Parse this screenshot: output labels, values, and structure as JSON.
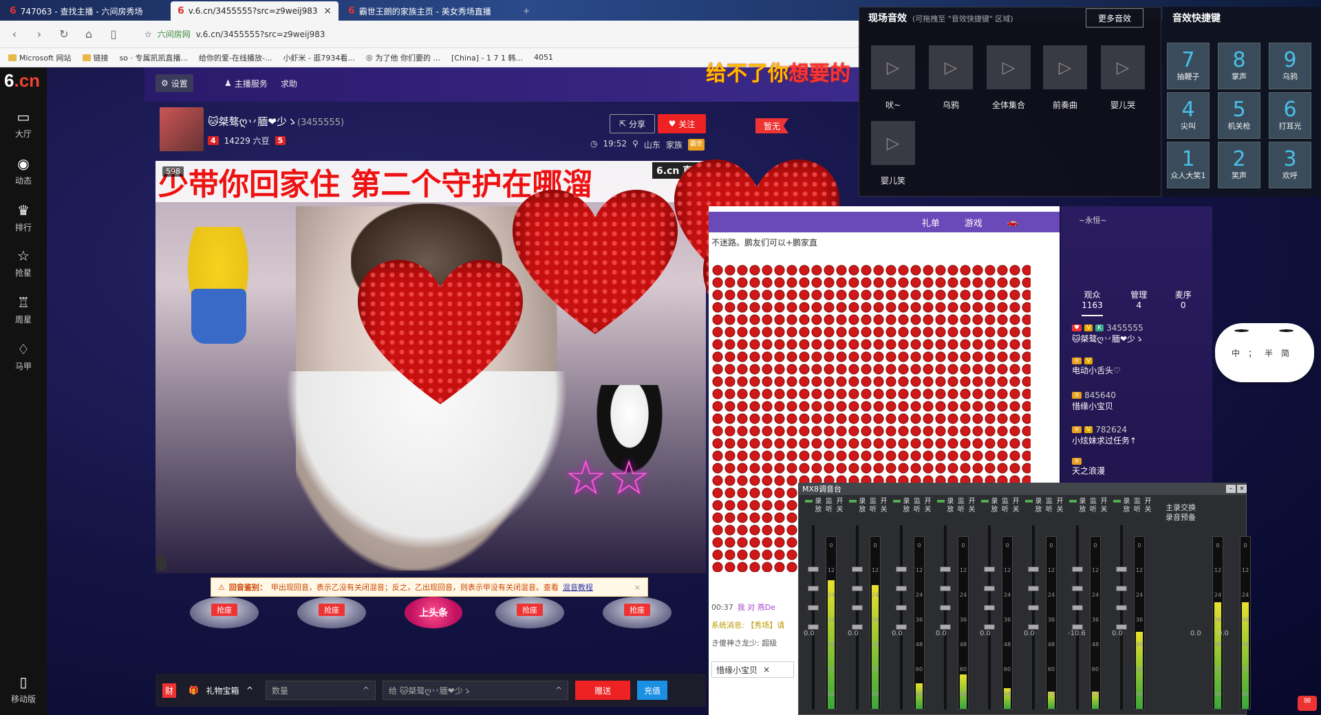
{
  "browser": {
    "tabs": [
      {
        "label": "747063 - 查找主播 - 六间房秀场",
        "active": false
      },
      {
        "label": "v.6.cn/3455555?src=z9weij983",
        "active": true
      },
      {
        "label": "霸世王朗的家族主页 - 美女秀场直播",
        "active": false
      }
    ],
    "url_site": "六间房网",
    "url": "v.6.cn/3455555?src=z9weij983",
    "bookmarks": [
      "Microsoft 网站",
      "链接",
      "so · 专属凯凯直播...",
      "给你的爱-在线播放-...",
      "小虾米 - 逛7934看...",
      "为了他 你们要的 ...",
      "[China] - 1 7 1 韩...",
      "4051"
    ]
  },
  "site": {
    "logo_top": "六间房",
    "logo_main": "6",
    "logo_accent": ".cn",
    "leftnav": [
      {
        "label": "大厅",
        "icon": "tv-icon"
      },
      {
        "label": "动态",
        "icon": "compass-icon"
      },
      {
        "label": "排行",
        "icon": "crown-icon"
      },
      {
        "label": "抢星",
        "icon": "star-icon"
      },
      {
        "label": "周星",
        "icon": "cup-icon"
      },
      {
        "label": "马甲",
        "icon": "shirt-icon"
      }
    ],
    "mobile_label": "移动版",
    "topbar": {
      "settings": "设置",
      "host_service": "主播服务",
      "help": "求助"
    }
  },
  "anchor": {
    "name": "🐱桀骜ღ丷腼❤少ゝ",
    "id": "(3455555)",
    "level": "4",
    "beans": "14229 六豆",
    "fans_level": "5",
    "share": "分享",
    "follow": "关注",
    "time": "19:52",
    "location": "山东",
    "family_label": "家族",
    "family_badge": "霸世",
    "flag": "暂无"
  },
  "video": {
    "banner": "少带你回家住  第二个守护在哪溜",
    "viewers_badge": "598",
    "logo": "6.cn 直播",
    "echo_label": "回音鉴别：",
    "echo_text": "甲出现回音，表示乙没有关闭混音；反之，乙出现回音，则表示甲没有关闭混音。查看",
    "echo_link": "混音教程",
    "seat_label": "抢座",
    "headline": "上头条"
  },
  "giftbar": {
    "box": "礼物宝箱",
    "qty_placeholder": "数量",
    "to": "给 🐱桀骜ღ丷腼❤少ゝ",
    "send": "赠送",
    "recharge": "充值"
  },
  "chat": {
    "tabs": [
      "礼单",
      "游戏"
    ],
    "notice": "不迷路。鹏友们可以+鹏家直",
    "lines": [
      {
        "time": "00:37",
        "text": "我 对 燕De"
      },
      {
        "time": "",
        "text": "系统消息: 【秀场】请"
      },
      {
        "time": "",
        "text": "き傻神さ龙少: 超级"
      }
    ],
    "input_name": "惜缘小宝贝"
  },
  "audience": {
    "tabs": [
      {
        "label": "观众",
        "count": "1163"
      },
      {
        "label": "管理",
        "count": "4"
      },
      {
        "label": "麦序",
        "count": "0"
      }
    ],
    "items": [
      {
        "id": "3455555",
        "name": "🐱桀骜ღ丷腼❤少ゝ"
      },
      {
        "id": "",
        "name": "电动小舌头♡"
      },
      {
        "id": "845640",
        "name": "惜缘小宝贝"
      },
      {
        "id": "782624",
        "name": "小炫妹求过任务↑"
      },
      {
        "id": "",
        "name": "天之浪漫"
      }
    ],
    "top_user": "~永恒~",
    "panda_text": "中；半简"
  },
  "sfx": {
    "title": "现场音效",
    "hint": "(可拖拽至 \"音效快捷键\" 区域)",
    "more": "更多音效",
    "items": [
      "吠~",
      "乌鸦",
      "全体集合",
      "前奏曲",
      "婴儿哭",
      "婴儿笑"
    ],
    "marquee_a": "给不了你",
    "marquee_b": "想要的"
  },
  "shortcuts": {
    "title": "音效快捷键",
    "keys": [
      {
        "n": "7",
        "label": "抽鞭子"
      },
      {
        "n": "8",
        "label": "掌声"
      },
      {
        "n": "9",
        "label": "乌鸦"
      },
      {
        "n": "4",
        "label": "尖叫"
      },
      {
        "n": "5",
        "label": "机关枪"
      },
      {
        "n": "6",
        "label": "打耳光"
      },
      {
        "n": "1",
        "label": "众人大笑1"
      },
      {
        "n": "2",
        "label": "笑声"
      },
      {
        "n": "3",
        "label": "欢呼"
      }
    ]
  },
  "mixer": {
    "title": "MX8调音台",
    "ch_labels": [
      "录放",
      "监听",
      "开关"
    ],
    "main_labels": [
      "主录交换",
      "录音预备"
    ],
    "scale": [
      "0",
      "12",
      "24",
      "36",
      "48",
      "60",
      "68"
    ],
    "db_values": [
      "0.0",
      "0.0",
      "0.0",
      "0.0",
      "0.0",
      "0.0",
      "-10.6",
      "0.0",
      "0.0",
      "0.0"
    ],
    "levels": [
      0.75,
      0.72,
      0.15,
      0.2,
      0.12,
      0.1,
      0.1,
      0.45,
      0.62,
      0.62
    ]
  }
}
